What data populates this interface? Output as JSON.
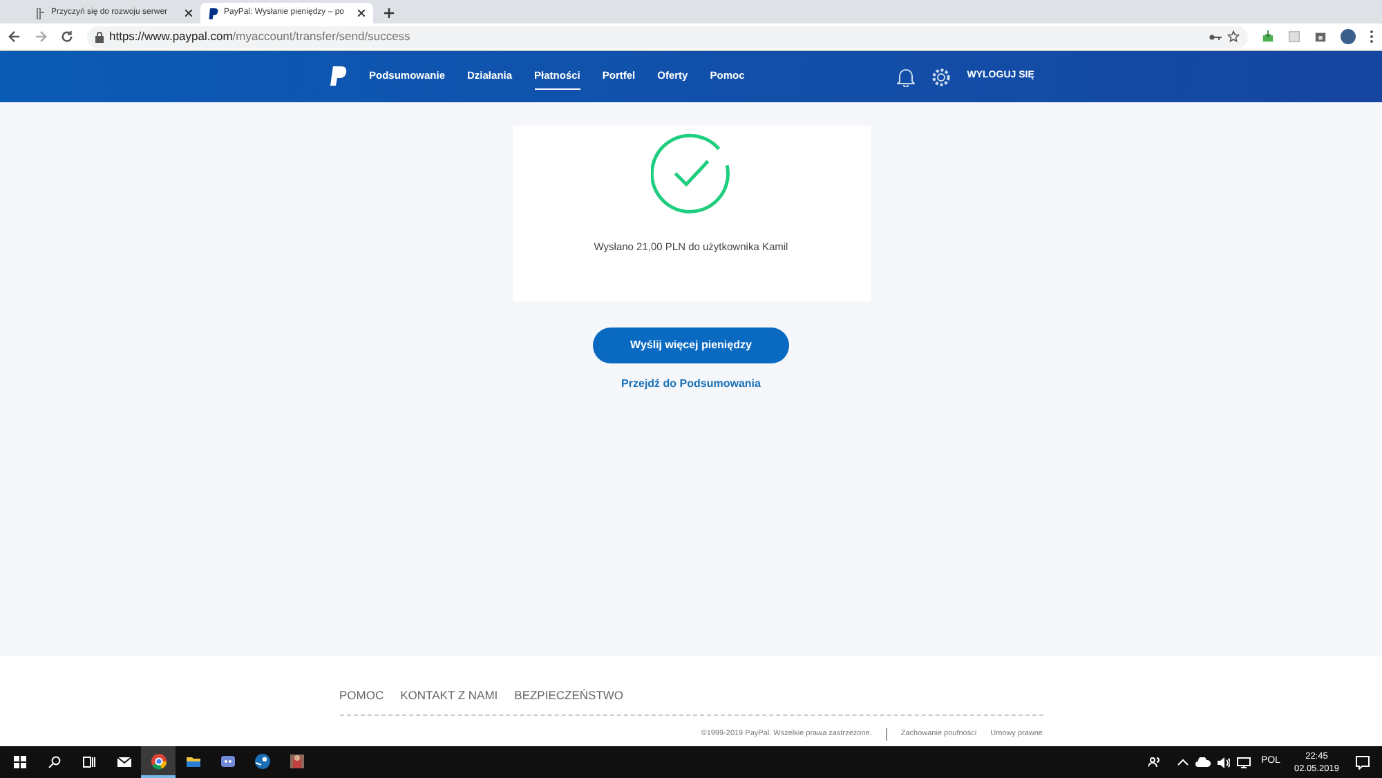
{
  "browser": {
    "tabs": [
      {
        "title": "Przyczyń się do rozwoju serwer",
        "selected": false
      },
      {
        "title": "PayPal: Wysłanie pieniędzy – po",
        "selected": true
      }
    ],
    "url_host": "https://www.paypal.com",
    "url_path": "/myaccount/transfer/send/success"
  },
  "nav": {
    "items": [
      {
        "label": "Podsumowanie",
        "selected": false
      },
      {
        "label": "Działania",
        "selected": false
      },
      {
        "label": "Płatności",
        "selected": true
      },
      {
        "label": "Portfel",
        "selected": false
      },
      {
        "label": "Oferty",
        "selected": false
      },
      {
        "label": "Pomoc",
        "selected": false
      }
    ],
    "logout": "WYLOGUJ SIĘ"
  },
  "success": {
    "message": "Wysłano 21,00 PLN do użytkownika Kamil",
    "primary_button": "Wyślij więcej pieniędzy",
    "link": "Przejdź do Podsumowania"
  },
  "footer": {
    "links": [
      "POMOC",
      "KONTAKT Z NAMI",
      "BEZPIECZEŃSTWO"
    ],
    "copyright": "©1999-2019 PayPal. Wszelkie prawa zastrzeżone.",
    "legal_links": [
      "Zachowanie poufności",
      "Umowy prawne"
    ]
  },
  "taskbar": {
    "apps": [
      {
        "kind": "mail",
        "selected": false
      },
      {
        "kind": "chrome",
        "selected": true
      },
      {
        "kind": "folder",
        "selected": false
      },
      {
        "kind": "discord",
        "selected": false
      },
      {
        "kind": "steam",
        "selected": false
      },
      {
        "kind": "game",
        "selected": false
      }
    ],
    "language": "POL",
    "time": "22:45",
    "date": "02.05.2019"
  }
}
